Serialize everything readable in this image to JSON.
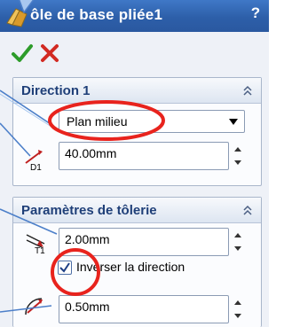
{
  "window": {
    "title": "ôle de base pliée1",
    "help_label": "?"
  },
  "panel_direction": {
    "title": "Direction 1",
    "end_condition": "Plan milieu",
    "depth_value": "40.00mm",
    "depth_icon_label": "D1"
  },
  "panel_sheet_metal": {
    "title": "Paramètres de tôlerie",
    "thickness_value": "2.00mm",
    "thickness_icon_label": "T1",
    "reverse_checked": true,
    "reverse_label": "Inverser la direction",
    "bend_radius_value": "0.50mm"
  },
  "colors": {
    "title_bar": "#2d5fa9",
    "highlight_circle": "#e8231d",
    "callout": "#4c7fc9",
    "panel_title": "#1f3f78"
  },
  "icons": {
    "ok": "green-check-icon",
    "cancel": "red-x-icon",
    "feature": "sheet-metal-feature-icon",
    "collapse": "double-chevron-up-icon"
  }
}
